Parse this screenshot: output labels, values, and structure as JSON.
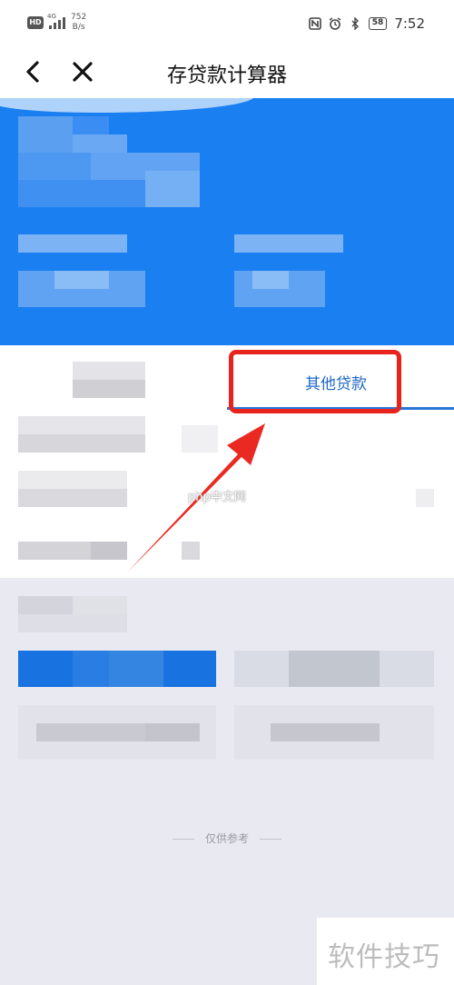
{
  "status_bar": {
    "hd_badge": "HD",
    "signal_tag": "4G",
    "net_speed_value": "752",
    "net_speed_unit": "B/s",
    "battery": "58",
    "time": "7:52"
  },
  "header": {
    "title": "存贷款计算器"
  },
  "tabs": {
    "active_label": "其他贷款"
  },
  "watermarks": {
    "php": "php中文网",
    "corner": "软件技巧"
  },
  "footer": {
    "note": "仅供参考"
  },
  "colors": {
    "brand_blue": "#1a7ff0",
    "tab_text": "#2068c9",
    "highlight_red": "#e8231d",
    "page_bg": "#e9e9f1"
  }
}
